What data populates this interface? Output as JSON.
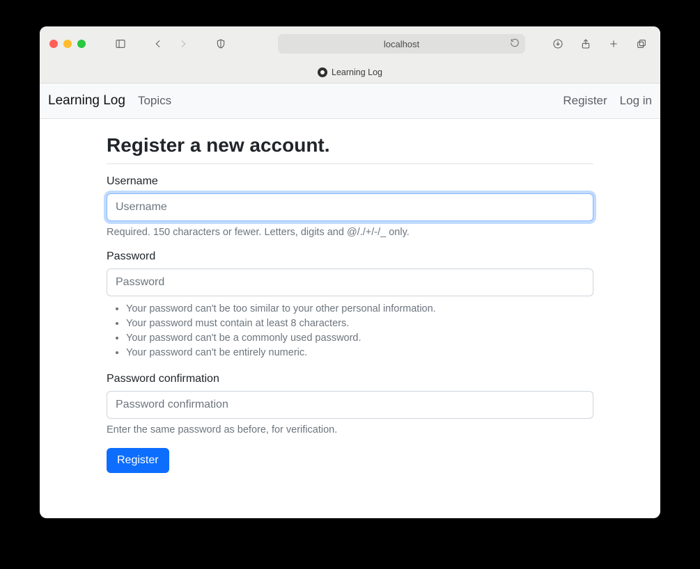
{
  "browser": {
    "address_text": "localhost",
    "tab_title": "Learning Log"
  },
  "navbar": {
    "brand": "Learning Log",
    "topics": "Topics",
    "register": "Register",
    "login": "Log in"
  },
  "page": {
    "title": "Register a new account."
  },
  "form": {
    "username": {
      "label": "Username",
      "placeholder": "Username",
      "help": "Required. 150 characters or fewer. Letters, digits and @/./+/-/_ only."
    },
    "password": {
      "label": "Password",
      "placeholder": "Password",
      "rules": [
        "Your password can't be too similar to your other personal information.",
        "Your password must contain at least 8 characters.",
        "Your password can't be a commonly used password.",
        "Your password can't be entirely numeric."
      ]
    },
    "password_confirm": {
      "label": "Password confirmation",
      "placeholder": "Password confirmation",
      "help": "Enter the same password as before, for verification."
    },
    "submit_label": "Register"
  }
}
